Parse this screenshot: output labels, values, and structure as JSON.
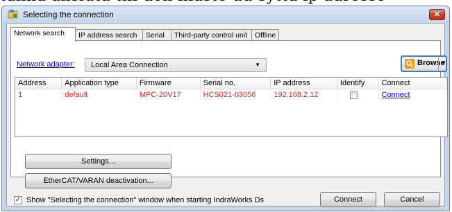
{
  "background_text": "tallna ansluta till den lilaste du-sytta ip adresse",
  "window": {
    "title": "Selecting the connection",
    "close_label": "✕",
    "app_icon": "network-folder-icon"
  },
  "tabs": [
    {
      "label": "Network search",
      "active": true
    },
    {
      "label": "IP address search",
      "active": false
    },
    {
      "label": "Serial",
      "active": false
    },
    {
      "label": "Third-party control unit",
      "active": false
    },
    {
      "label": "Offline",
      "active": false
    }
  ],
  "adapter": {
    "label": "Network adapter:",
    "value": "Local Area Connection"
  },
  "browse": {
    "label": "Browse",
    "icon": "search-icon"
  },
  "table": {
    "headers": [
      "Address",
      "Application type",
      "Firmware",
      "Serial no.",
      "IP address",
      "Identify",
      "Connect"
    ],
    "rows": [
      {
        "address": "1",
        "application_type": "default",
        "firmware": "MPC-20V17",
        "serial_no": "HCS021-03056",
        "ip_address": "192.168.2.12",
        "identify": false,
        "connect": "Connect"
      }
    ]
  },
  "buttons": {
    "settings": "Settings...",
    "ethercat": "EtherCAT/VARAN deactivation...",
    "connect": "Connect",
    "cancel": "Cancel"
  },
  "footer": {
    "show_window_checked": true,
    "show_window_label": "Show \"Selecting the connection\" window when starting IndraWorks Ds"
  },
  "colors": {
    "row_text": "#e0231d",
    "link": "#0000ee",
    "accent": "#3c7fb1"
  }
}
